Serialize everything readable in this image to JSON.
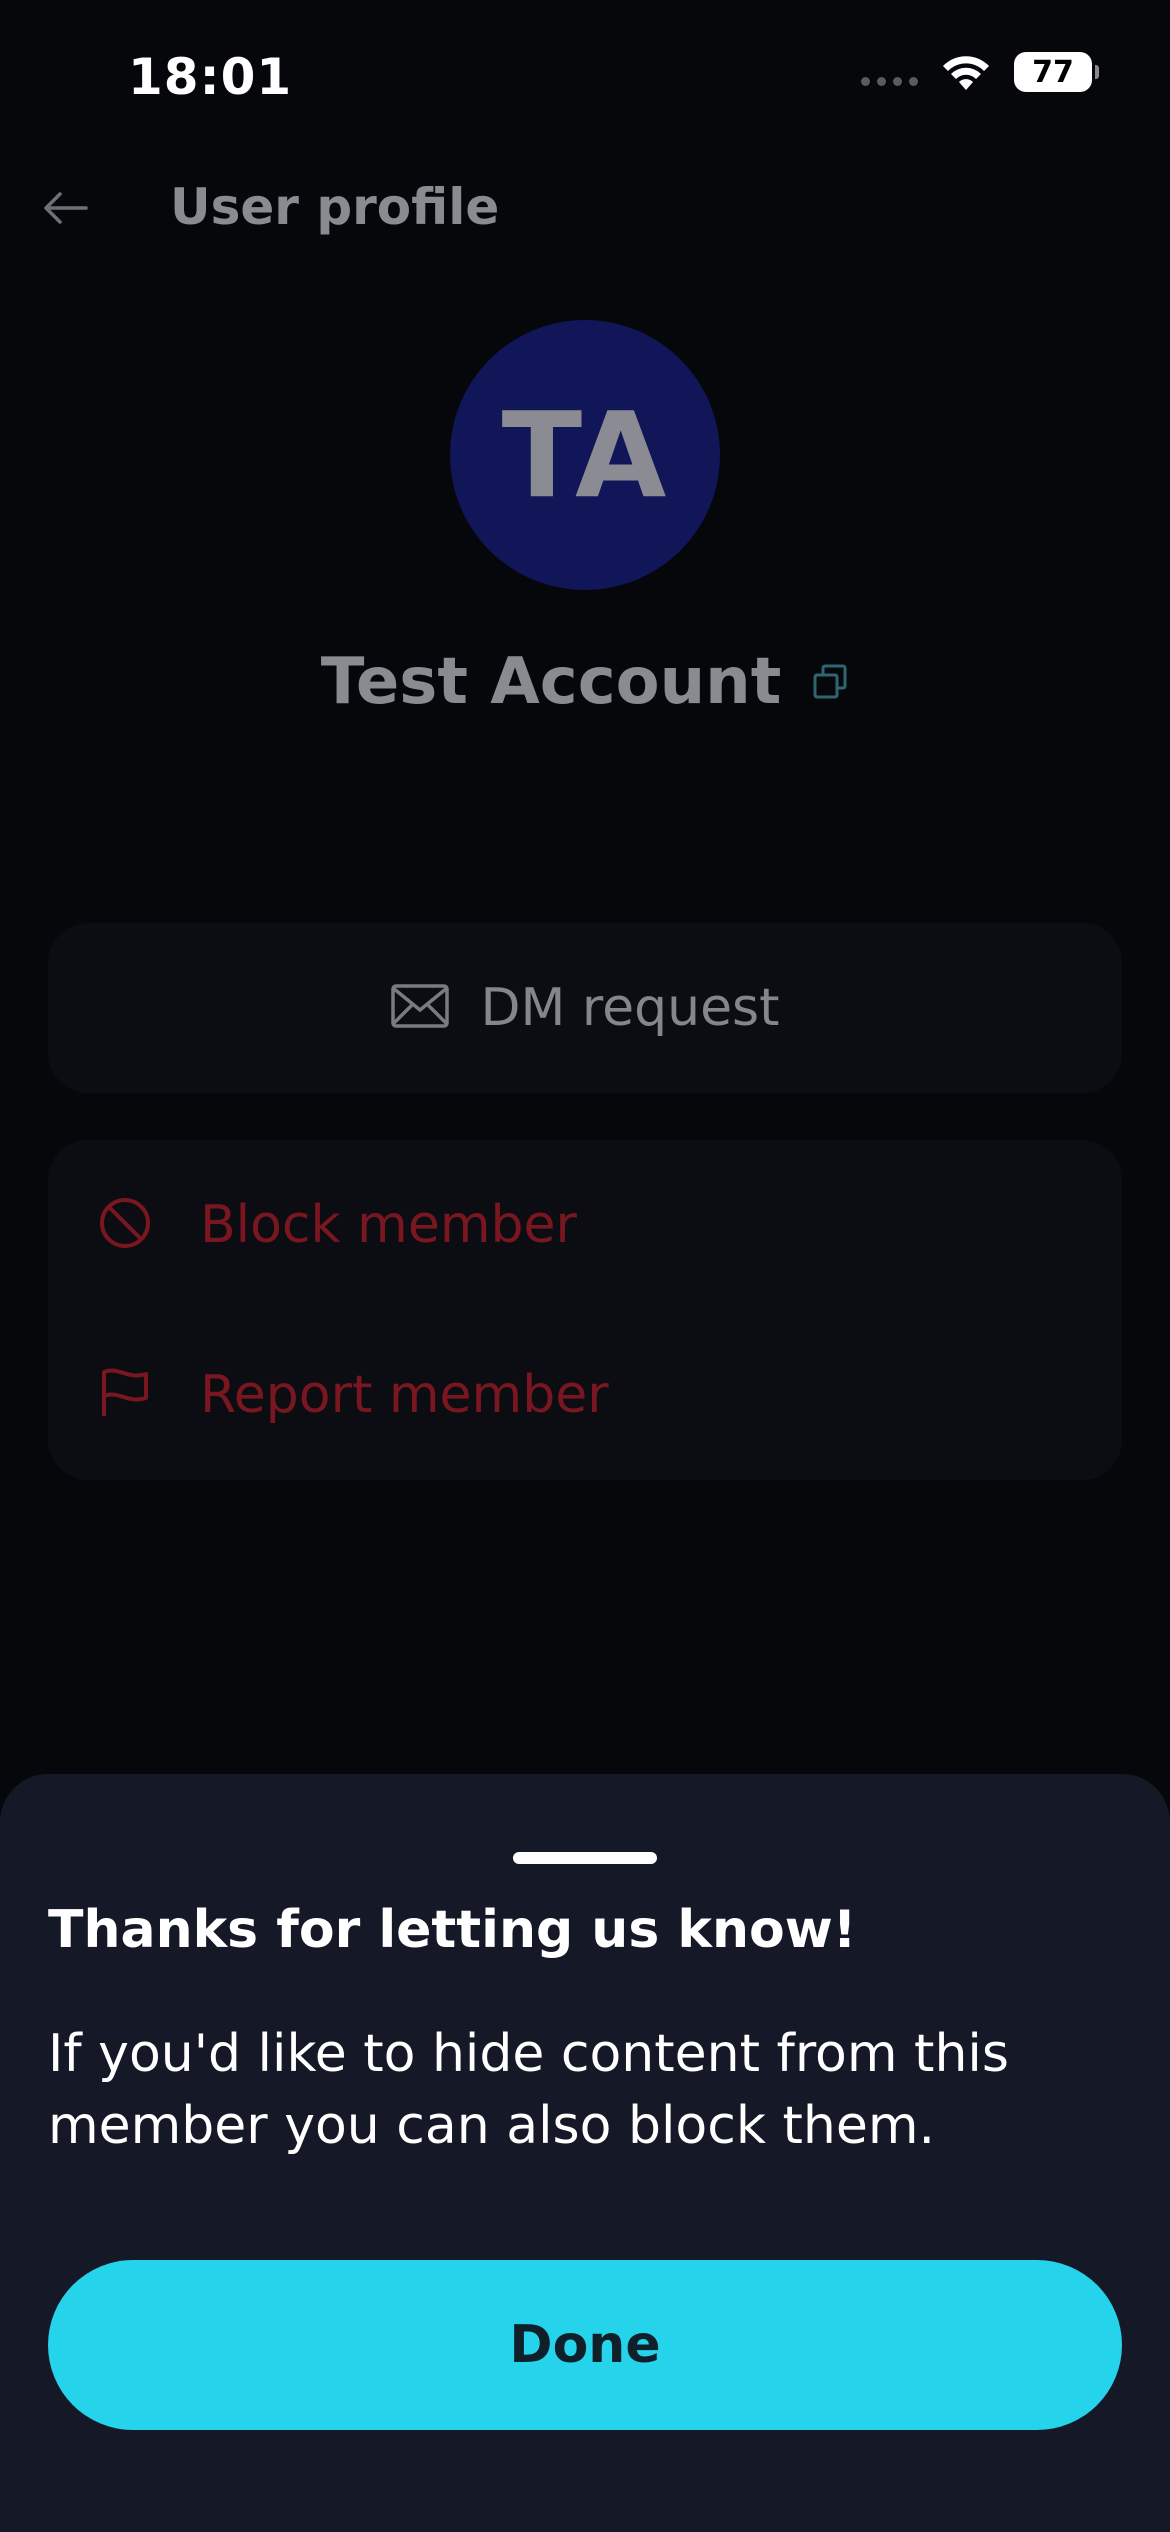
{
  "status_bar": {
    "time": "18:01",
    "battery": "77",
    "icons": [
      "signal-icon",
      "wifi-icon",
      "battery-icon"
    ]
  },
  "header": {
    "title": "User profile",
    "back_icon": "arrow-left-icon"
  },
  "profile": {
    "initials": "TA",
    "name": "Test Account",
    "avatar_color": "#101657",
    "copy_icon": "copy-icon"
  },
  "actions": {
    "dm_label": "DM request",
    "dm_icon": "envelope-icon",
    "block_label": "Block member",
    "block_icon": "block-icon",
    "report_label": "Report member",
    "report_icon": "flag-icon",
    "danger_color": "#7a1620"
  },
  "sheet": {
    "title": "Thanks for letting us know!",
    "body": "If you'd like to hide content from this member you can also block them.",
    "done_label": "Done",
    "accent_color": "#25d3ea"
  }
}
